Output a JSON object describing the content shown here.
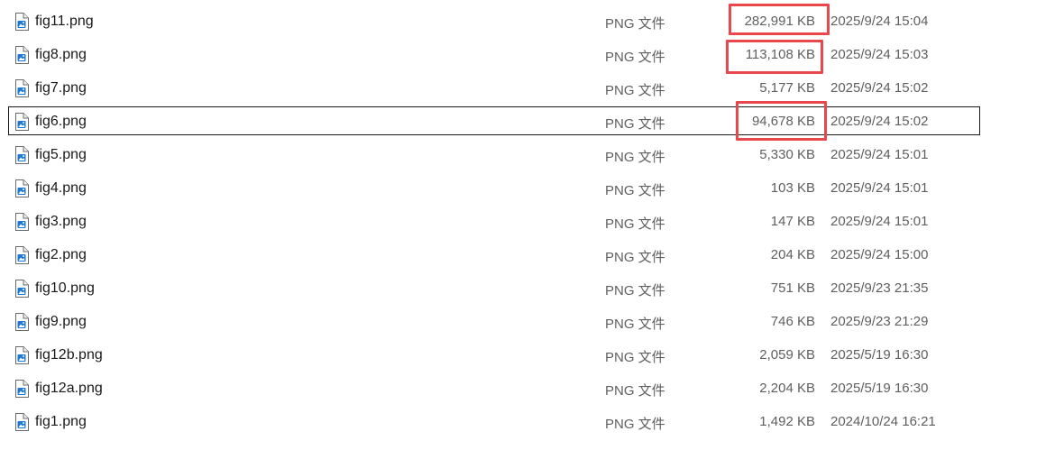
{
  "files": [
    {
      "name": "fig11.png",
      "type": "PNG 文件",
      "size": "282,991 KB",
      "modified": "2025/9/24 15:04",
      "icon": "png-file-icon"
    },
    {
      "name": "fig8.png",
      "type": "PNG 文件",
      "size": "113,108 KB",
      "modified": "2025/9/24 15:03",
      "icon": "png-file-icon"
    },
    {
      "name": "fig7.png",
      "type": "PNG 文件",
      "size": "5,177 KB",
      "modified": "2025/9/24 15:02",
      "icon": "png-file-icon"
    },
    {
      "name": "fig6.png",
      "type": "PNG 文件",
      "size": "94,678 KB",
      "modified": "2025/9/24 15:02",
      "icon": "png-file-icon",
      "focused": true
    },
    {
      "name": "fig5.png",
      "type": "PNG 文件",
      "size": "5,330 KB",
      "modified": "2025/9/24 15:01",
      "icon": "png-file-icon"
    },
    {
      "name": "fig4.png",
      "type": "PNG 文件",
      "size": "103 KB",
      "modified": "2025/9/24 15:01",
      "icon": "png-file-icon"
    },
    {
      "name": "fig3.png",
      "type": "PNG 文件",
      "size": "147 KB",
      "modified": "2025/9/24 15:01",
      "icon": "png-file-icon"
    },
    {
      "name": "fig2.png",
      "type": "PNG 文件",
      "size": "204 KB",
      "modified": "2025/9/24 15:00",
      "icon": "png-file-icon"
    },
    {
      "name": "fig10.png",
      "type": "PNG 文件",
      "size": "751 KB",
      "modified": "2025/9/23 21:35",
      "icon": "png-file-icon"
    },
    {
      "name": "fig9.png",
      "type": "PNG 文件",
      "size": "746 KB",
      "modified": "2025/9/23 21:29",
      "icon": "png-file-icon"
    },
    {
      "name": "fig12b.png",
      "type": "PNG 文件",
      "size": "2,059 KB",
      "modified": "2025/5/19 16:30",
      "icon": "png-file-icon"
    },
    {
      "name": "fig12a.png",
      "type": "PNG 文件",
      "size": "2,204 KB",
      "modified": "2025/5/19 16:30",
      "icon": "png-file-icon"
    },
    {
      "name": "fig1.png",
      "type": "PNG 文件",
      "size": "1,492 KB",
      "modified": "2024/10/24 16:21",
      "icon": "png-file-icon"
    }
  ],
  "highlight_color": "#e8474e",
  "highlighted_sizes": [
    "fig11.png",
    "fig8.png",
    "fig6.png"
  ]
}
